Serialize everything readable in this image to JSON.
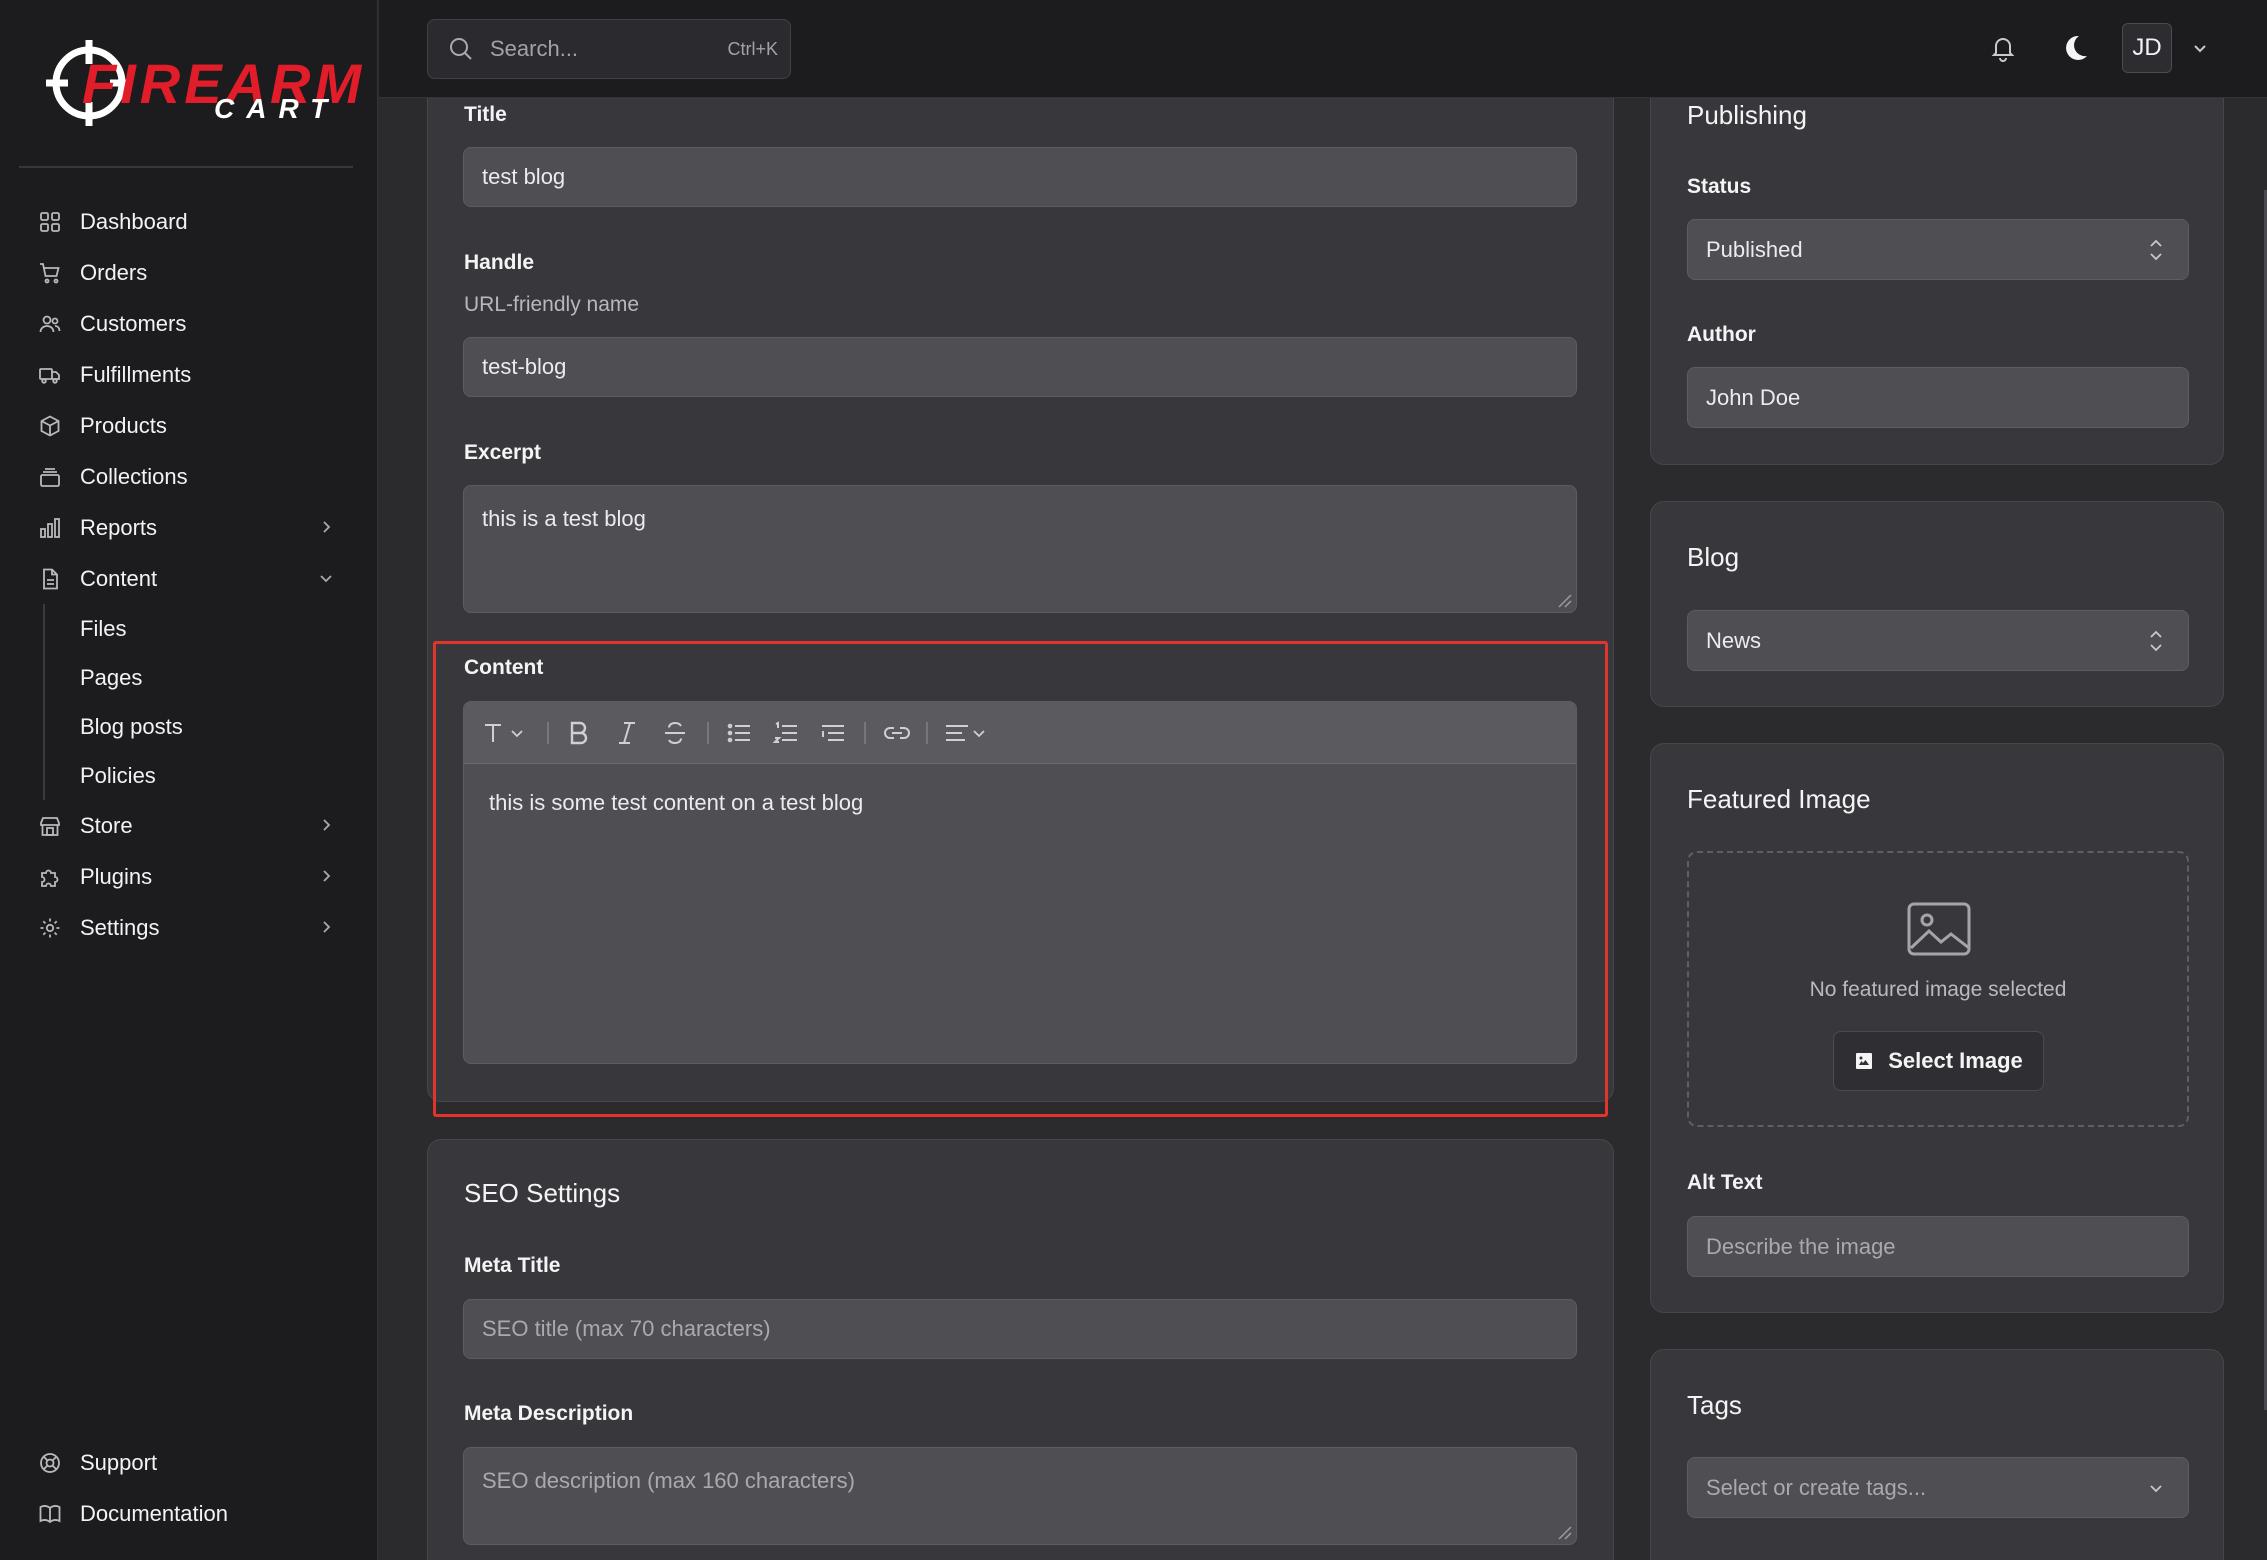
{
  "brand": {
    "word": "FIREARM",
    "sub": "CART",
    "accent": "#e11d2a"
  },
  "search": {
    "placeholder": "Search...",
    "shortcut": "Ctrl+K"
  },
  "topbar": {
    "avatar_initials": "JD"
  },
  "sidebar": {
    "items": [
      {
        "label": "Dashboard",
        "icon": "grid-icon"
      },
      {
        "label": "Orders",
        "icon": "cart-icon"
      },
      {
        "label": "Customers",
        "icon": "users-icon"
      },
      {
        "label": "Fulfillments",
        "icon": "truck-icon"
      },
      {
        "label": "Products",
        "icon": "box-icon"
      },
      {
        "label": "Collections",
        "icon": "layers-icon"
      },
      {
        "label": "Reports",
        "icon": "bar-chart-icon"
      },
      {
        "label": "Content",
        "icon": "file-icon"
      }
    ],
    "content_sub": [
      "Files",
      "Pages",
      "Blog posts",
      "Policies"
    ],
    "items_after": [
      {
        "label": "Store",
        "icon": "store-icon"
      },
      {
        "label": "Plugins",
        "icon": "puzzle-icon"
      },
      {
        "label": "Settings",
        "icon": "gear-icon"
      }
    ],
    "bottom": [
      {
        "label": "Support",
        "icon": "lifebuoy-icon"
      },
      {
        "label": "Documentation",
        "icon": "book-icon"
      }
    ]
  },
  "main": {
    "title_label": "Title",
    "title_value": "test blog",
    "handle_label": "Handle",
    "handle_hint": "URL-friendly name",
    "handle_value": "test-blog",
    "excerpt_label": "Excerpt",
    "excerpt_value": "this is a test blog",
    "content_label": "Content",
    "content_value": "this is some test content on a test blog"
  },
  "seo": {
    "title": "SEO Settings",
    "meta_title_label": "Meta Title",
    "meta_title_placeholder": "SEO title (max 70 characters)",
    "meta_desc_label": "Meta Description",
    "meta_desc_placeholder": "SEO description (max 160 characters)"
  },
  "publishing": {
    "title": "Publishing",
    "status_label": "Status",
    "status_value": "Published",
    "author_label": "Author",
    "author_value": "John Doe"
  },
  "blog": {
    "title": "Blog",
    "value": "News"
  },
  "featured": {
    "title": "Featured Image",
    "empty_text": "No featured image selected",
    "button": "Select Image",
    "alt_label": "Alt Text",
    "alt_placeholder": "Describe the image"
  },
  "tags": {
    "title": "Tags",
    "placeholder": "Select or create tags..."
  }
}
